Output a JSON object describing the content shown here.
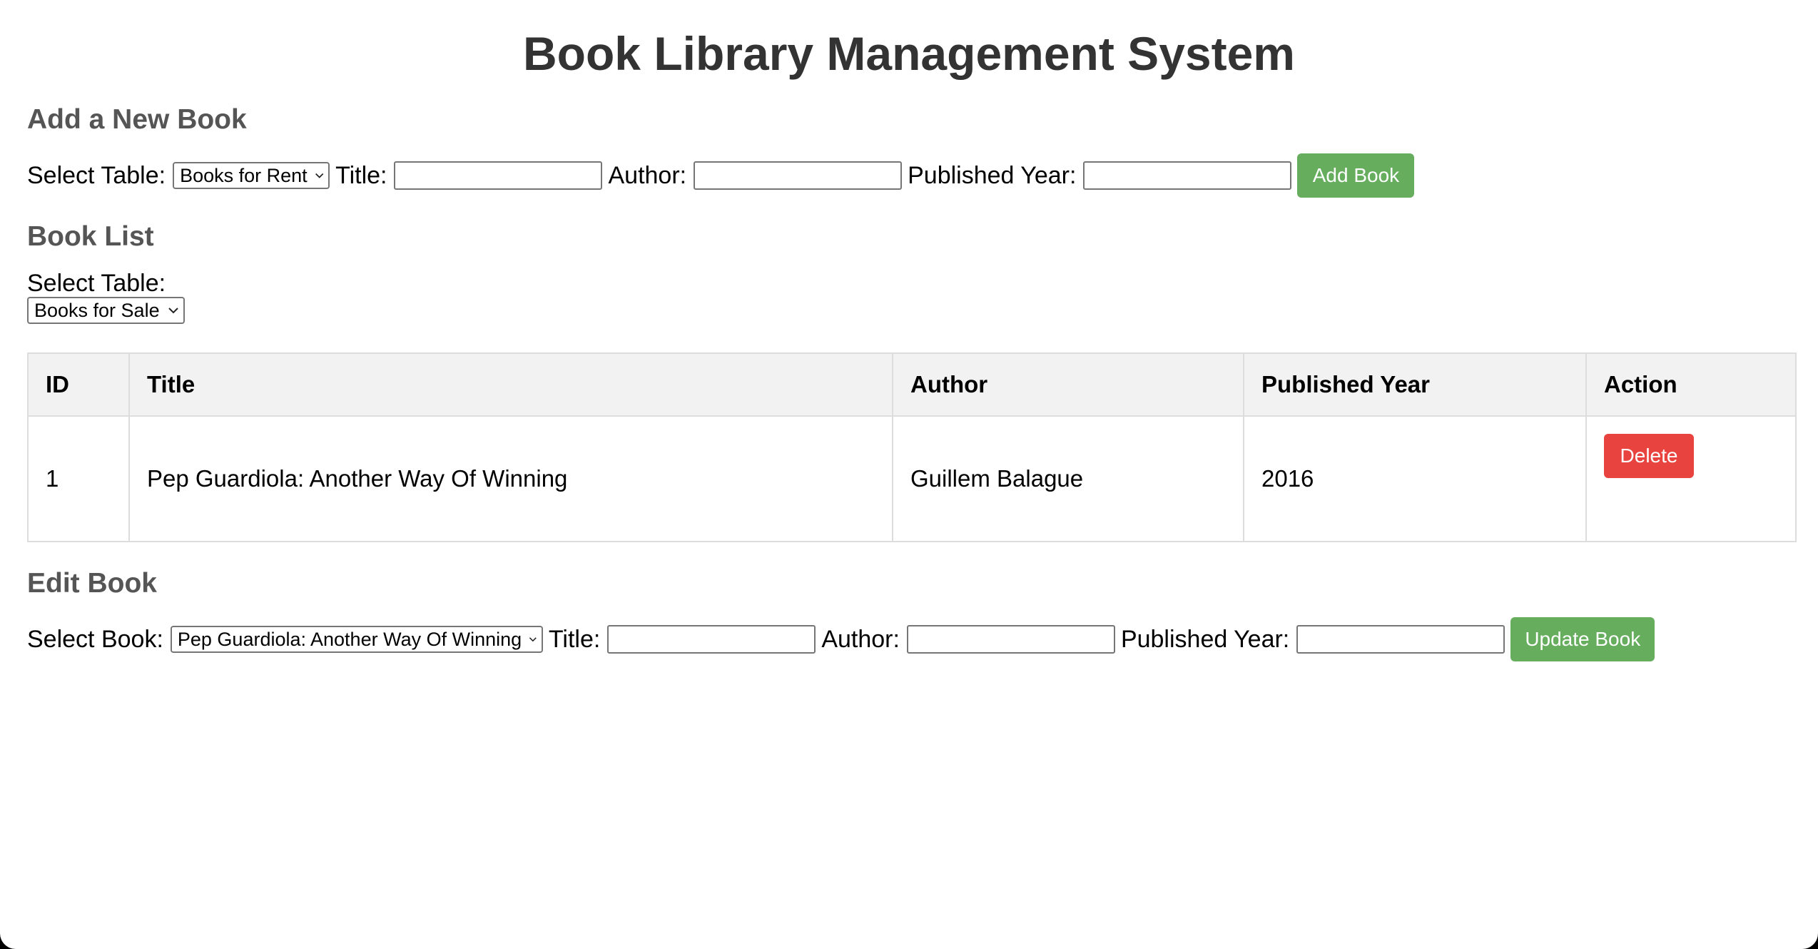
{
  "page_title": "Book Library Management System",
  "add_section": {
    "heading": "Add a New Book",
    "select_table_label": "Select Table:",
    "select_table_value": "Books for Rent",
    "title_label": "Title:",
    "title_value": "",
    "author_label": "Author:",
    "author_value": "",
    "year_label": "Published Year:",
    "year_value": "",
    "button_label": "Add Book"
  },
  "list_section": {
    "heading": "Book List",
    "select_table_label": "Select Table:",
    "select_table_value": "Books for Sale",
    "columns": [
      "ID",
      "Title",
      "Author",
      "Published Year",
      "Action"
    ],
    "rows": [
      {
        "id": "1",
        "title": "Pep Guardiola: Another Way Of Winning",
        "author": "Guillem Balague",
        "year": "2016",
        "action_label": "Delete"
      }
    ]
  },
  "edit_section": {
    "heading": "Edit Book",
    "select_book_label": "Select Book:",
    "select_book_value": "Pep Guardiola: Another Way Of Winning",
    "title_label": "Title:",
    "title_value": "",
    "author_label": "Author:",
    "author_value": "",
    "year_label": "Published Year:",
    "year_value": "",
    "button_label": "Update Book"
  },
  "colors": {
    "green_button": "#66ad5e",
    "red_button": "#e8433f",
    "heading": "#555555",
    "title": "#333333"
  }
}
